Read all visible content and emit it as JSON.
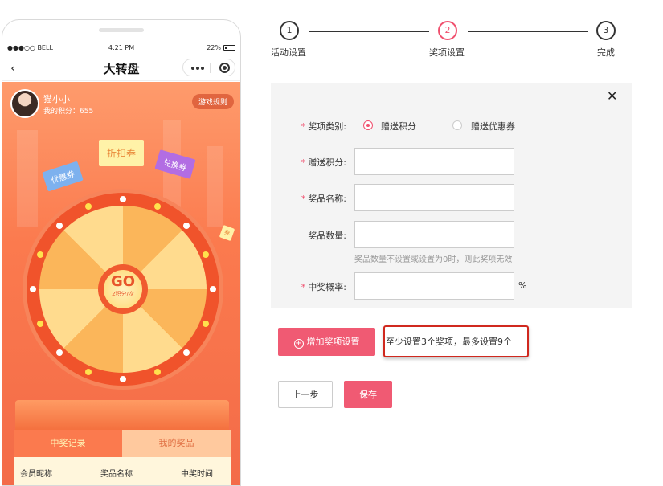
{
  "phone": {
    "status": {
      "carrier": "●●●○○ BELL",
      "time": "4:21 PM",
      "battery": "22%"
    },
    "nav_title": "大转盘",
    "user": {
      "name": "猫小小",
      "points": "我的积分：655"
    },
    "rules_label": "游戏规则",
    "tickets": [
      "优惠券",
      "折扣券",
      "兑换券",
      "券"
    ],
    "go_label": "GO",
    "go_cost": "2积分/次",
    "tabs": [
      "中奖记录",
      "我的奖品"
    ],
    "table_headers": [
      "会员昵称",
      "奖品名称",
      "中奖时间"
    ]
  },
  "stepper": {
    "steps": [
      {
        "num": "1",
        "label": "活动设置"
      },
      {
        "num": "2",
        "label": "奖项设置"
      },
      {
        "num": "3",
        "label": "完成"
      }
    ],
    "active_index": 1
  },
  "form": {
    "category_label": "奖项类别:",
    "category_options": [
      "赠送积分",
      "赠送优惠券"
    ],
    "category_selected": 0,
    "points_label": "赠送积分:",
    "points_value": "",
    "name_label": "奖品名称:",
    "name_value": "",
    "quantity_label": "奖品数量:",
    "quantity_value": "",
    "quantity_hint": "奖品数量不设置或设置为0时，则此奖项无效",
    "probability_label": "中奖概率:",
    "probability_value": "",
    "probability_unit": "%"
  },
  "actions": {
    "add_label": "增加奖项设置",
    "note": "至少设置3个奖项，最多设置9个",
    "prev_label": "上一步",
    "save_label": "保存"
  },
  "colors": {
    "accent": "#f05a73",
    "step_active": "#f0506e",
    "highlight_border": "#d0281e"
  }
}
